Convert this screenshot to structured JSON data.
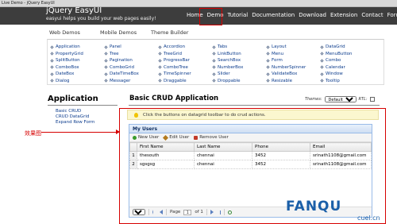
{
  "window": {
    "title": "Live Demo - jQuery EasyUI"
  },
  "header": {
    "logo": "jQuery EasyUI",
    "tagline": "easyui helps you build your web pages easily!",
    "nav": [
      "Home",
      "Demo",
      "Tutorial",
      "Documentation",
      "Download",
      "Extension",
      "Contact",
      "Forum"
    ]
  },
  "sub_tabs": [
    "Web Demos",
    "Mobile Demos",
    "Theme Builder"
  ],
  "demos": [
    "Application",
    "Panel",
    "Accordion",
    "Tabs",
    "Layout",
    "DataGrid",
    "PropertyGrid",
    "Tree",
    "TreeGrid",
    "LinkButton",
    "Menu",
    "MenuButton",
    "SplitButton",
    "Pagination",
    "ProgressBar",
    "SearchBox",
    "Form",
    "Combo",
    "ComboBox",
    "ComboGrid",
    "ComboTree",
    "NumberBox",
    "NumberSpinner",
    "Calendar",
    "DateBox",
    "DateTimeBox",
    "TimeSpinner",
    "Slider",
    "ValidateBox",
    "Window",
    "Dialog",
    "Messager",
    "Draggable",
    "Droppable",
    "Resizable",
    "Tooltip"
  ],
  "application": {
    "title": "Application",
    "links": [
      "Basic CRUD",
      "CRUD DataGrid",
      "Expand Row Form"
    ]
  },
  "annotation": "效果图",
  "main": {
    "title": "Basic CRUD Application",
    "themes_label": "Themes:",
    "theme_value": "Default",
    "rtl_label": "RTL:",
    "notice": "Click the buttons on datagrid toolbar to do crud actions."
  },
  "grid": {
    "title": "My Users",
    "toolbar": {
      "new": "New User",
      "edit": "Edit User",
      "remove": "Remove User"
    },
    "columns": [
      "First Name",
      "Last Name",
      "Phone",
      "Email"
    ],
    "rows": [
      {
        "n": "1",
        "first": "thesouth",
        "last": "chennai",
        "phone": "3452",
        "email": "srinath1108@gmail.com"
      },
      {
        "n": "2",
        "first": "sgsgsg",
        "last": "chennai",
        "phone": "3452",
        "email": "srinath1108@gmail.com"
      }
    ],
    "pager": {
      "page_size": "10",
      "page_label": "Page",
      "page": "1",
      "of_label": "of 1"
    }
  },
  "watermark": {
    "text": "FANQU",
    "sub": "cuel.cn"
  }
}
